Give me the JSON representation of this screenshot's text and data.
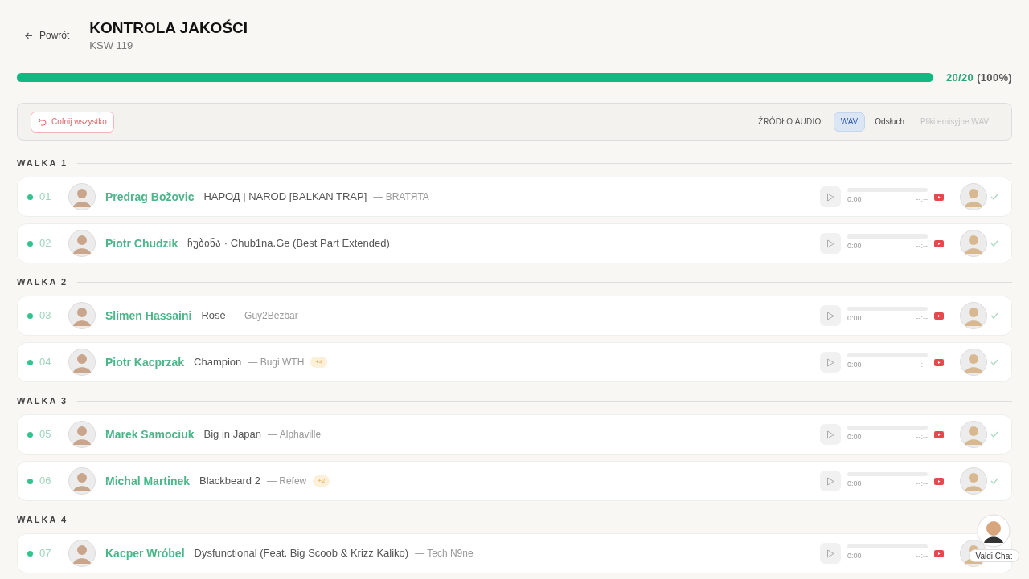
{
  "back": {
    "label": "Powrót"
  },
  "title": "KONTROLA JAKOŚCI",
  "subtitle": "KSW 119",
  "progress": {
    "level": 1,
    "count": "20/20",
    "percent": "(100%)"
  },
  "toolbar": {
    "undo": "Cofnij wszystko",
    "source_label": "ŹRÓDŁO AUDIO:",
    "sources": [
      {
        "label": "WAV",
        "selected": true,
        "disabled": false
      },
      {
        "label": "Odsłuch",
        "selected": false,
        "disabled": false
      },
      {
        "label": "Pliki emisyjne WAV",
        "selected": false,
        "disabled": true
      }
    ]
  },
  "sections": [
    {
      "label": "WALKA 1",
      "rows": [
        {
          "number": "01",
          "color": "#34c38f",
          "name": "Predrag Božovic",
          "title": "НАРОД | NAROD [BALKAN TRAP]",
          "artist": "— BRATЯTA",
          "time": "0:00",
          "duration": "--:--",
          "checked": true
        },
        {
          "number": "02",
          "color": "#34c38f",
          "name": "Piotr Chudzik",
          "title": "ჩუბინა · Chub1na.Ge (Best Part Extended)",
          "time": "0:00",
          "duration": "--:--",
          "checked": true
        }
      ]
    },
    {
      "label": "WALKA 2",
      "rows": [
        {
          "number": "03",
          "color": "#34c38f",
          "name": "Slimen Hassaini",
          "title": "Rosé",
          "artist": "— Guy2Bezbar",
          "time": "0:00",
          "duration": "--:--",
          "checked": true
        },
        {
          "number": "04",
          "color": "#34c38f",
          "name": "Piotr Kacprzak",
          "title": "Champion",
          "artist": "— Bugi WTH",
          "badge": "+4",
          "time": "0:00",
          "duration": "--:--",
          "checked": true
        }
      ]
    },
    {
      "label": "WALKA 3",
      "rows": [
        {
          "number": "05",
          "color": "#34c38f",
          "name": "Marek Samociuk",
          "title": "Big in Japan",
          "artist": "— Alphaville",
          "time": "0:00",
          "duration": "--:--",
          "checked": true
        },
        {
          "number": "06",
          "color": "#34c38f",
          "name": "Michal Martinek",
          "title": "Blackbeard 2",
          "artist": "— Refew",
          "badge": "+2",
          "time": "0:00",
          "duration": "--:--",
          "checked": true
        }
      ]
    },
    {
      "label": "WALKA 4",
      "rows": [
        {
          "number": "07",
          "color": "#34c38f",
          "name": "Kacper Wróbel",
          "title": "Dysfunctional (Feat. Big Scoob & Krizz Kaliko)",
          "artist": "— Tech N9ne",
          "time": "0:00",
          "duration": "--:--"
        }
      ]
    }
  ],
  "chat": {
    "label": "Valdi Chat"
  }
}
